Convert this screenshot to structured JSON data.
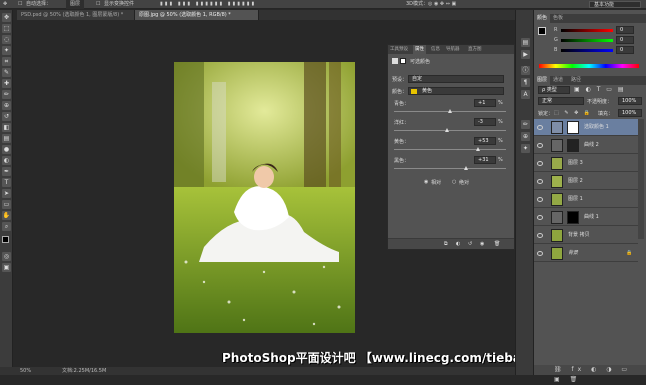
{
  "options_bar": {
    "auto_select": "自动选择：",
    "auto_select_value": "图层",
    "show_transform": "显示变换控件",
    "workspace": "基本功能"
  },
  "tabs": [
    {
      "label": "PSD.psd @ 50% (选取颜色 1, 图层蒙版/8) *",
      "active": false
    },
    {
      "label": "原图.jpg @ 50% (选取颜色 1, RGB/8) *",
      "active": true
    }
  ],
  "status": {
    "zoom": "50%",
    "doc": "文档:2.25M/16.5M"
  },
  "watermark": "PhotoShop平面设计吧 【www.linecg.com/tieba/1783】",
  "properties": {
    "tabs": [
      "工具预设",
      "属性",
      "信息",
      "导航器",
      "直方图"
    ],
    "title": "可选颜色",
    "preset_label": "预设：",
    "preset_value": "自定",
    "colors_label": "颜色：",
    "colors_value": "黄色",
    "sliders": [
      {
        "label": "青色：",
        "value": "+1",
        "pct": "%"
      },
      {
        "label": "洋红：",
        "value": "-3",
        "pct": "%"
      },
      {
        "label": "黄色：",
        "value": "+53",
        "pct": "%"
      },
      {
        "label": "黑色：",
        "value": "+31",
        "pct": "%"
      }
    ],
    "method_relative": "相对",
    "method_absolute": "绝对"
  },
  "color_panel": {
    "tabs": [
      "颜色",
      "色板"
    ],
    "r_value": "0",
    "g_value": "0",
    "b_value": "0",
    "r_label": "R",
    "g_label": "G",
    "b_label": "B"
  },
  "layers_panel": {
    "tabs": [
      "图层",
      "通道",
      "路径"
    ],
    "kind": "ρ 类型",
    "blend": "正常",
    "opacity_label": "不透明度：",
    "opacity": "100%",
    "lock_label": "锁定：",
    "fill_label": "填充：",
    "fill": "100%",
    "layers": [
      {
        "name": "选取颜色 1",
        "selected": true
      },
      {
        "name": "曲线 2",
        "selected": false
      },
      {
        "name": "图层 3",
        "selected": false
      },
      {
        "name": "图层 2",
        "selected": false
      },
      {
        "name": "图层 1",
        "selected": false
      },
      {
        "name": "曲线 1",
        "selected": false
      },
      {
        "name": "背景 拷贝",
        "selected": false
      },
      {
        "name": "背景",
        "selected": false
      }
    ]
  },
  "colors": {
    "accent": "#6a7fa0",
    "panel": "#535353",
    "yellow_swatch": "#e8c400"
  }
}
